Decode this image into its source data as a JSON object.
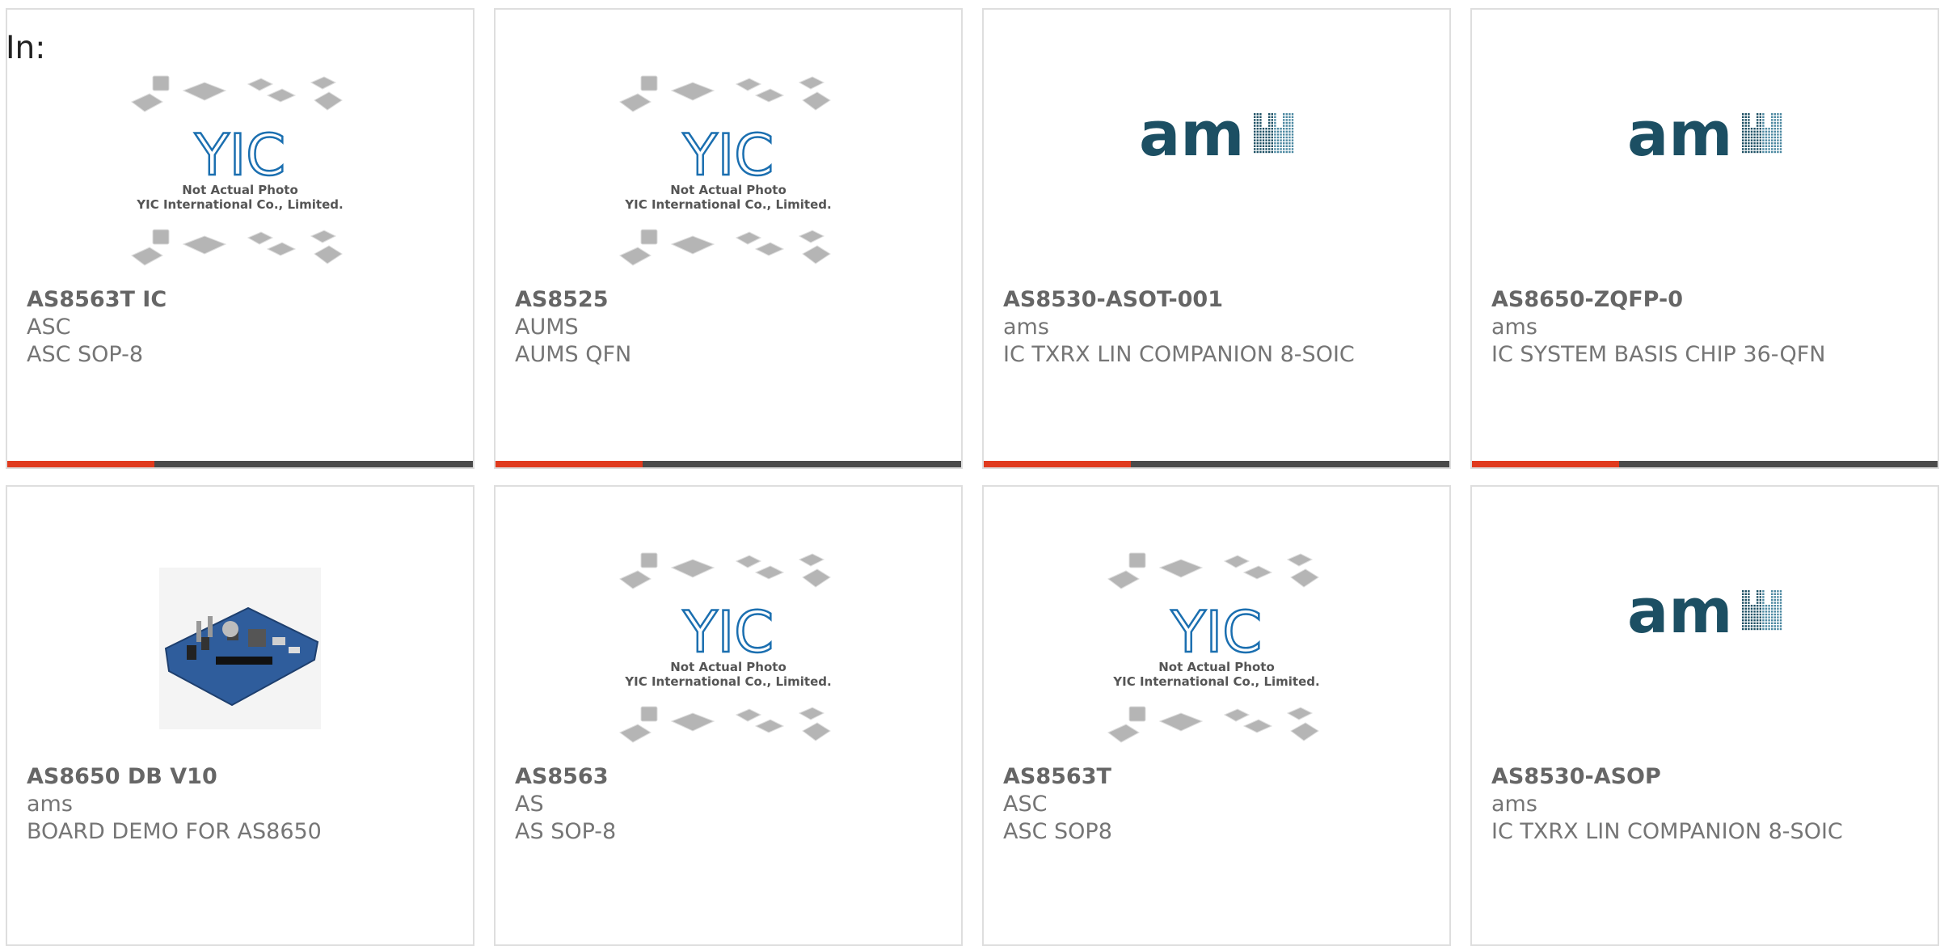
{
  "header": {
    "filter_label": "In:"
  },
  "products": [
    {
      "part": "AS8563T IC",
      "maker": "ASC",
      "desc": "ASC SOP-8",
      "image": "placeholder-photo"
    },
    {
      "part": "AS8525",
      "maker": "AUMS",
      "desc": "AUMS QFN",
      "image": "placeholder-photo"
    },
    {
      "part": "AS8530-ASOT-001",
      "maker": "ams",
      "desc": "IC TXRX LIN COMPANION 8-SOIC",
      "image": "ams-logo"
    },
    {
      "part": "AS8650-ZQFP-0",
      "maker": "ams",
      "desc": "IC SYSTEM BASIS CHIP 36-QFN",
      "image": "ams-logo"
    },
    {
      "part": "AS8650 DB V10",
      "maker": "ams",
      "desc": "BOARD DEMO FOR AS8650",
      "image": "demo-board-photo"
    },
    {
      "part": "AS8563",
      "maker": "AS",
      "desc": "AS SOP-8",
      "image": "placeholder-photo"
    },
    {
      "part": "AS8563T",
      "maker": "ASC",
      "desc": "ASC SOP8",
      "image": "placeholder-photo"
    },
    {
      "part": "AS8530-ASOP",
      "maker": "ams",
      "desc": "IC TXRX LIN COMPANION 8-SOIC",
      "image": "ams-logo"
    }
  ],
  "placeholder": {
    "line1": "Not Actual Photo",
    "line2": "YIC International Co., Limited.",
    "logo_text": "YIC"
  },
  "brand_logo": {
    "text": "am"
  },
  "colors": {
    "accent": "#e03a1e",
    "bar": "#4a4a4a",
    "ams_teal": "#1c4f63",
    "yic_blue": "#1b6fb0"
  }
}
